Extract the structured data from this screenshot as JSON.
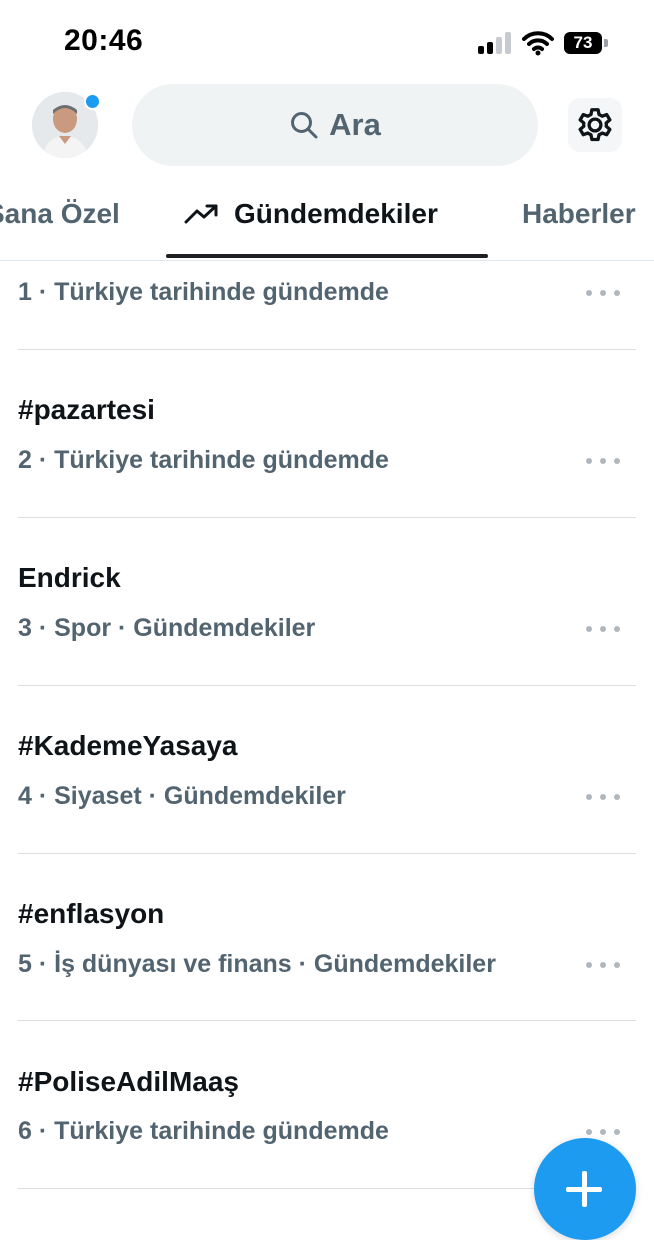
{
  "status_bar": {
    "time": "20:46",
    "battery": "73"
  },
  "header": {
    "search_label": "Ara",
    "avatar": "profile-photo",
    "notification_dot_color": "#1d9bf0"
  },
  "tabs": [
    {
      "label": "Sana Özel",
      "active": false
    },
    {
      "label": "Gündemdekiler",
      "active": true,
      "icon": "trending-icon"
    },
    {
      "label": "Haberler",
      "active": false
    }
  ],
  "trends": [
    {
      "name": "",
      "meta": "1 · Türkiye tarihinde gündemde"
    },
    {
      "name": "#pazartesi",
      "meta": "2 · Türkiye tarihinde gündemde"
    },
    {
      "name": "Endrick",
      "meta": "3 · Spor · Gündemdekiler"
    },
    {
      "name": "#KademeYasaya",
      "meta": "4 · Siyaset · Gündemdekiler"
    },
    {
      "name": "#enflasyon",
      "meta": "5 · İş dünyası ve finans · Gündemdekiler"
    },
    {
      "name": "#PoliseAdilMaaş",
      "meta": "6 · Türkiye tarihinde gündemde"
    }
  ],
  "colors": {
    "accent": "#1d9bf0",
    "text_primary": "#0f1419",
    "text_secondary": "#536471"
  }
}
